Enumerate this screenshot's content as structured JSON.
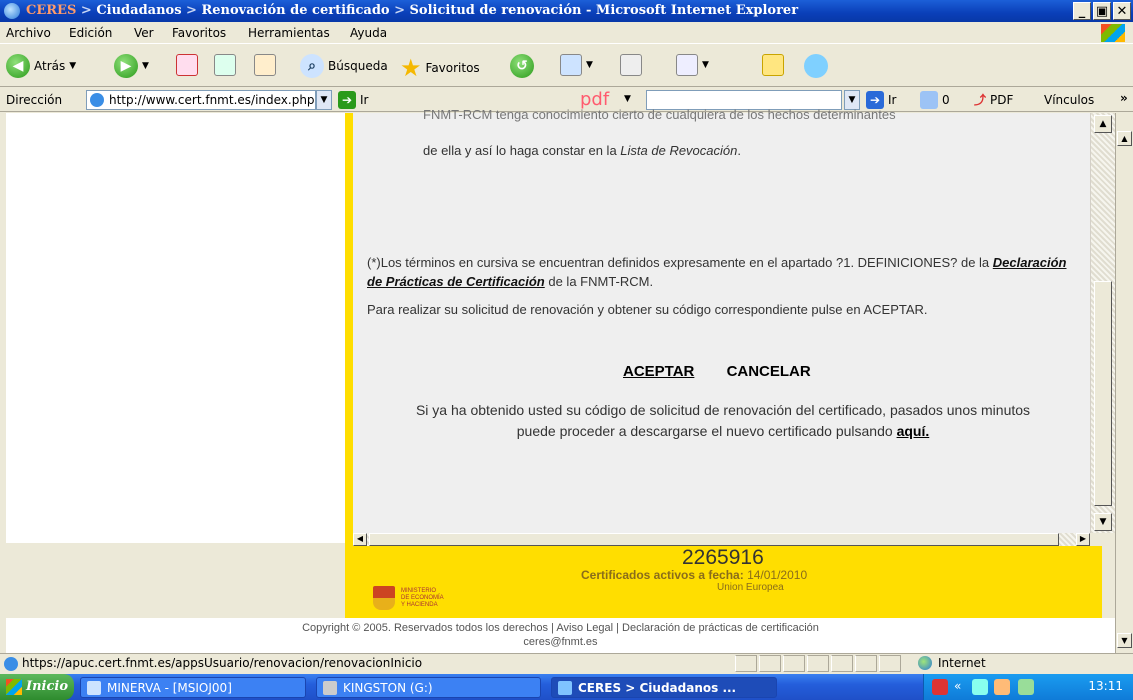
{
  "window": {
    "title_crumbs": [
      "CERES",
      "Ciudadanos",
      "Renovación de certificado",
      "Solicitud de renovación"
    ],
    "title_sep": " > ",
    "title_suffix": " - Microsoft Internet Explorer",
    "controls": {
      "minimize": "_",
      "maximize": "▣",
      "close": "✕"
    }
  },
  "menu": [
    "Archivo",
    "Edición",
    "Ver",
    "Favoritos",
    "Herramientas",
    "Ayuda"
  ],
  "toolbar": {
    "back": "Atrás",
    "search": "Búsqueda",
    "favorites": "Favoritos"
  },
  "address": {
    "label": "Dirección",
    "url": "http://www.cert.fnmt.es/index.php?cha=cit&sec=!",
    "go": "Ir",
    "pdf_brand": "pdf",
    "go2": "Ir",
    "count": "0",
    "pdf_button": "PDF",
    "links": "Vínculos",
    "more": "»"
  },
  "content": {
    "cut_line": "FNMT-RCM tenga conocimiento cierto de cualquiera de los hechos determinantes",
    "revocation_text": "de ella y así lo haga constar en la ",
    "revocation_link": "Lista de Revocación",
    "revocation_end": ".",
    "definitions_prefix": "(*)Los términos en cursiva se encuentran definidos expresamente en el apartado ?1. DEFINICIONES? de la ",
    "definitions_link": "Declaración de Prácticas de Certificación",
    "definitions_suffix": " de la FNMT-RCM.",
    "request_text": "Para realizar su solicitud de renovación y obtener su código correspondiente pulse en ACEPTAR.",
    "accept": "ACEPTAR",
    "cancel": "CANCELAR",
    "info_text": "Si ya ha obtenido usted su código de solicitud de renovación del certificado, pasados unos minutos puede proceder a descargarse el nuevo certificado pulsando ",
    "info_link": "aquí."
  },
  "footer": {
    "count": "2265916",
    "certs_label": "Certificados activos a fecha: ",
    "certs_date": "14/01/2010",
    "eu": "Union Europea",
    "ministry": [
      "MINISTERIO",
      "DE ECONOMÍA",
      "Y HACIENDA"
    ]
  },
  "copyright": {
    "line1": "Copyright © 2005. Reservados todos los derechos | Aviso Legal | Declaración de prácticas de certificación",
    "line2": "ceres@fnmt.es"
  },
  "status": {
    "url": "https://apuc.cert.fnmt.es/appsUsuario/renovacion/renovacionInicio",
    "zone": "Internet"
  },
  "taskbar": {
    "start": "Inicio",
    "tasks": [
      "MINERVA - [MSIOJ00]",
      "KINGSTON (G:)",
      "CERES > Ciudadanos ..."
    ],
    "clock": "13:11",
    "tray_chevron": "«"
  },
  "colors": {
    "ie_blue": "#0a3fb8",
    "fnmt_yellow": "#ffde00",
    "title_crumb": "#ff9c6a"
  }
}
